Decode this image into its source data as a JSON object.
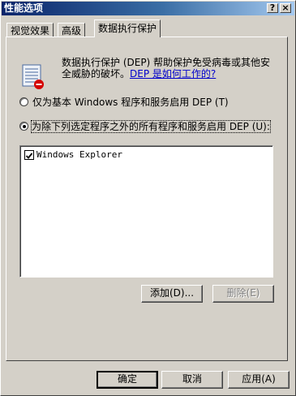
{
  "window": {
    "title": "性能选项"
  },
  "titlebar": {
    "help_label": "?",
    "close_label": "×"
  },
  "tabs": [
    {
      "label": "视觉效果"
    },
    {
      "label": "高级"
    },
    {
      "label": "数据执行保护"
    }
  ],
  "dep": {
    "description_line1": "数据执行保护 (DEP) 帮助保护免受病毒或其他安",
    "description_line2": "全威胁的破坏。",
    "link_text": "DEP 是如何工作的?",
    "option_basic": "仅为基本 Windows 程序和服务启用 DEP (T)",
    "option_all": "为除下列选定程序之外的所有程序和服务启用 DEP (U):",
    "selected_option": "option_all",
    "list_items": [
      {
        "label": "Windows Explorer",
        "checked": true
      }
    ],
    "add_button": "添加(D)...",
    "remove_button": "删除(E)"
  },
  "footer": {
    "ok": "确定",
    "cancel": "取消",
    "apply": "应用(A)"
  },
  "colors": {
    "face": "#d4d0c8",
    "title_start": "#0a246a",
    "link": "#0000cc"
  },
  "icons": {
    "dep_icon": "memory-chip-shield-icon"
  }
}
